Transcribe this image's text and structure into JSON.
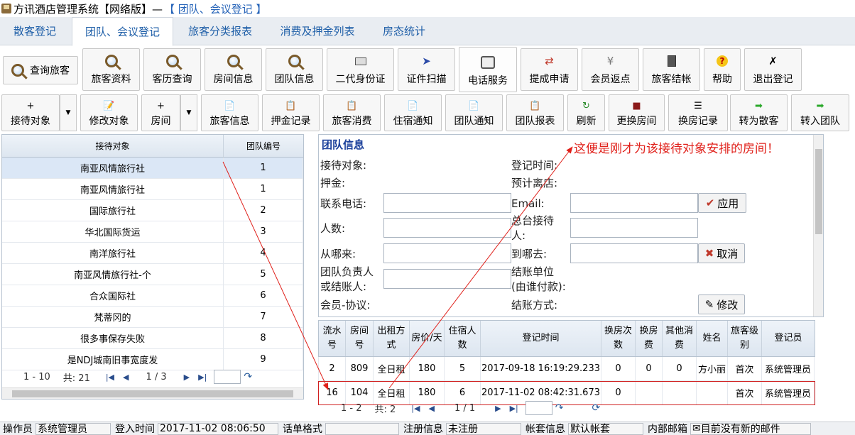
{
  "title": {
    "main": "方讯酒店管理系统【网络版】—",
    "sub": "【 团队、会议登记 】"
  },
  "tabs": [
    "散客登记",
    "团队、会议登记",
    "旅客分类报表",
    "消费及押金列表",
    "房态统计"
  ],
  "toolbar1": [
    "查询旅客",
    "旅客资料",
    "客历查询",
    "房间信息",
    "团队信息",
    "二代身份证",
    "证件扫描",
    "电话服务",
    "提成申请",
    "会员返点",
    "旅客结帐",
    "帮助",
    "退出登记"
  ],
  "toolbar2": [
    "接待对象",
    "修改对象",
    "房间",
    "旅客信息",
    "押金记录",
    "旅客消费",
    "住宿通知",
    "团队通知",
    "团队报表",
    "刷新",
    "更换房间",
    "换房记录",
    "转为散客",
    "转入团队"
  ],
  "left_grid": {
    "headers": [
      "接待对象",
      "团队编号"
    ],
    "rows": [
      [
        "南亚风情旅行社",
        "1"
      ],
      [
        "南亚风情旅行社",
        "1"
      ],
      [
        "国际旅行社",
        "2"
      ],
      [
        "华北国际货运",
        "3"
      ],
      [
        "南洋旅行社",
        "4"
      ],
      [
        "南亚风情旅行社-个",
        "5"
      ],
      [
        "合众国际社",
        "6"
      ],
      [
        "梵蒂冈的",
        "7"
      ],
      [
        "很多事保存失败",
        "8"
      ],
      [
        "是NDJ城南旧事宽度发",
        "9"
      ]
    ],
    "pager": {
      "range": "1 - 10",
      "total": "共: 21",
      "page": "1 / 3"
    }
  },
  "info": {
    "title": "团队信息",
    "labels": {
      "reception": "接待对象:",
      "reg_time": "登记时间:",
      "deposit": "押金:",
      "checkout_est": "预计离店:",
      "phone": "联系电话:",
      "email": "Email:",
      "people": "人数:",
      "desk1": "总台接待",
      "desk2": "人:",
      "from": "从哪来:",
      "to": "到哪去:",
      "leader1": "团队负责人",
      "leader2": "或结账人:",
      "unit1": "结账单位",
      "unit2": "(由谁付款):",
      "member": "会员-协议:",
      "pay": "结账方式:"
    },
    "buttons": {
      "apply": "应用",
      "cancel": "取消",
      "modify": "修改"
    }
  },
  "annotation": "这便是刚才为该接待对象安排的房间！",
  "room_grid": {
    "headers": [
      "流水号",
      "房间号",
      "出租方式",
      "房价/天",
      "住宿人数",
      "登记时间",
      "换房次数",
      "换房费",
      "其他消费",
      "姓名",
      "旅客级别",
      "登记员"
    ],
    "rows": [
      [
        "2",
        "809",
        "全日租",
        "180",
        "5",
        "2017-09-18 16:19:29.233",
        "0",
        "0",
        "0",
        "方小丽",
        "首次",
        "系统管理员"
      ],
      [
        "16",
        "104",
        "全日租",
        "180",
        "6",
        "2017-11-02 08:42:31.673",
        "0",
        "",
        "",
        "",
        "首次",
        "系统管理员"
      ]
    ],
    "pager": {
      "range": "1 - 2",
      "total": "共: 2",
      "page": "1 / 1"
    }
  },
  "status": {
    "operator_label": "操作员",
    "operator": "系统管理员",
    "login_label": "登入时间",
    "login": "2017-11-02 08:06:50",
    "format_label": "话单格式",
    "format": "",
    "reg_label": "注册信息",
    "reg": "未注册",
    "account_label": "帐套信息",
    "account": "默认帐套",
    "mail_label": "内部邮箱",
    "mail": "目前没有新的邮件"
  },
  "colors": {
    "annotation": "#e0201a",
    "accent": "#1f5fa8"
  }
}
